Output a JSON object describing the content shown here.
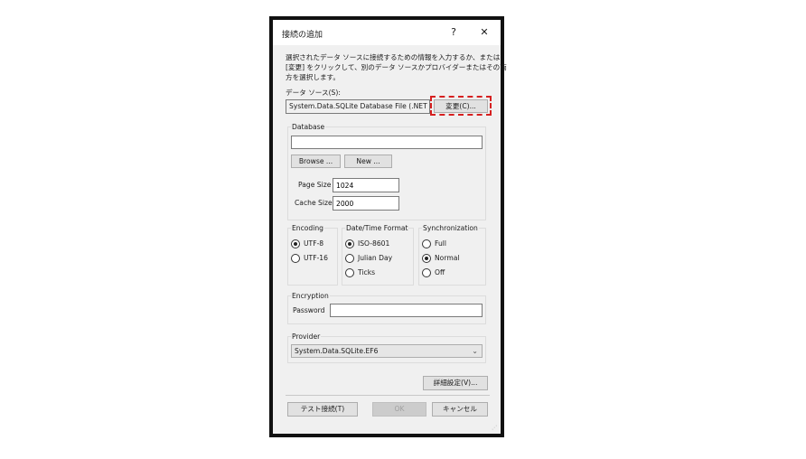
{
  "dialog": {
    "title": "接続の追加",
    "help": "?",
    "close": "✕"
  },
  "description": {
    "line1": "選択されたデータ ソースに接続するための情報を入力するか、または",
    "line2": "[変更] をクリックして、別のデータ ソースかプロバイダーまたはその両",
    "line3": "方を選択します。"
  },
  "datasource": {
    "label": "データ ソース(S):",
    "value": "System.Data.SQLite Database File (.NET Fr",
    "change_button": "変更(C)..."
  },
  "database": {
    "group_title": "Database",
    "path_value": "",
    "browse_button": "Browse ...",
    "new_button": "New ...",
    "page_size_label": "Page Size",
    "page_size_value": "1024",
    "cache_size_label": "Cache Size",
    "cache_size_value": "2000"
  },
  "encoding": {
    "group_title": "Encoding",
    "options": [
      "UTF-8",
      "UTF-16"
    ],
    "selected": "UTF-8"
  },
  "datetime": {
    "group_title": "Date/Time Format",
    "options": [
      "ISO-8601",
      "Julian Day",
      "Ticks"
    ],
    "selected": "ISO-8601"
  },
  "sync": {
    "group_title": "Synchronization",
    "options": [
      "Full",
      "Normal",
      "Off"
    ],
    "selected": "Normal"
  },
  "encryption": {
    "group_title": "Encryption",
    "password_label": "Password",
    "password_value": ""
  },
  "provider": {
    "group_title": "Provider",
    "selected": "System.Data.SQLite.EF6"
  },
  "buttons": {
    "advanced": "詳細設定(V)...",
    "test": "テスト接続(T)",
    "ok": "OK",
    "cancel": "キャンセル"
  },
  "colors": {
    "highlight": "#d62020",
    "dialog_bg": "#f0f0f0",
    "frame": "#111111"
  }
}
